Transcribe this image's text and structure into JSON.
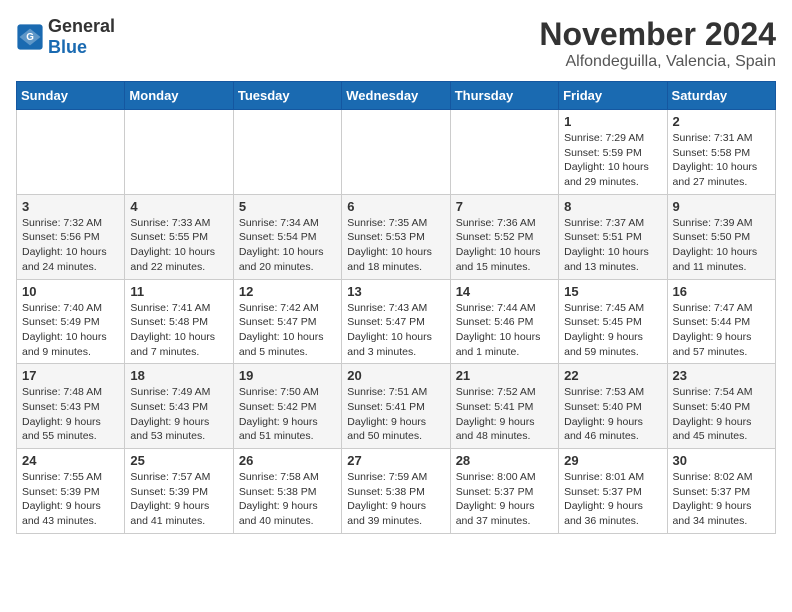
{
  "logo": {
    "text_general": "General",
    "text_blue": "Blue"
  },
  "header": {
    "month": "November 2024",
    "location": "Alfondeguilla, Valencia, Spain"
  },
  "weekdays": [
    "Sunday",
    "Monday",
    "Tuesday",
    "Wednesday",
    "Thursday",
    "Friday",
    "Saturday"
  ],
  "weeks": [
    [
      {
        "day": "",
        "info": ""
      },
      {
        "day": "",
        "info": ""
      },
      {
        "day": "",
        "info": ""
      },
      {
        "day": "",
        "info": ""
      },
      {
        "day": "",
        "info": ""
      },
      {
        "day": "1",
        "info": "Sunrise: 7:29 AM\nSunset: 5:59 PM\nDaylight: 10 hours and 29 minutes."
      },
      {
        "day": "2",
        "info": "Sunrise: 7:31 AM\nSunset: 5:58 PM\nDaylight: 10 hours and 27 minutes."
      }
    ],
    [
      {
        "day": "3",
        "info": "Sunrise: 7:32 AM\nSunset: 5:56 PM\nDaylight: 10 hours and 24 minutes."
      },
      {
        "day": "4",
        "info": "Sunrise: 7:33 AM\nSunset: 5:55 PM\nDaylight: 10 hours and 22 minutes."
      },
      {
        "day": "5",
        "info": "Sunrise: 7:34 AM\nSunset: 5:54 PM\nDaylight: 10 hours and 20 minutes."
      },
      {
        "day": "6",
        "info": "Sunrise: 7:35 AM\nSunset: 5:53 PM\nDaylight: 10 hours and 18 minutes."
      },
      {
        "day": "7",
        "info": "Sunrise: 7:36 AM\nSunset: 5:52 PM\nDaylight: 10 hours and 15 minutes."
      },
      {
        "day": "8",
        "info": "Sunrise: 7:37 AM\nSunset: 5:51 PM\nDaylight: 10 hours and 13 minutes."
      },
      {
        "day": "9",
        "info": "Sunrise: 7:39 AM\nSunset: 5:50 PM\nDaylight: 10 hours and 11 minutes."
      }
    ],
    [
      {
        "day": "10",
        "info": "Sunrise: 7:40 AM\nSunset: 5:49 PM\nDaylight: 10 hours and 9 minutes."
      },
      {
        "day": "11",
        "info": "Sunrise: 7:41 AM\nSunset: 5:48 PM\nDaylight: 10 hours and 7 minutes."
      },
      {
        "day": "12",
        "info": "Sunrise: 7:42 AM\nSunset: 5:47 PM\nDaylight: 10 hours and 5 minutes."
      },
      {
        "day": "13",
        "info": "Sunrise: 7:43 AM\nSunset: 5:47 PM\nDaylight: 10 hours and 3 minutes."
      },
      {
        "day": "14",
        "info": "Sunrise: 7:44 AM\nSunset: 5:46 PM\nDaylight: 10 hours and 1 minute."
      },
      {
        "day": "15",
        "info": "Sunrise: 7:45 AM\nSunset: 5:45 PM\nDaylight: 9 hours and 59 minutes."
      },
      {
        "day": "16",
        "info": "Sunrise: 7:47 AM\nSunset: 5:44 PM\nDaylight: 9 hours and 57 minutes."
      }
    ],
    [
      {
        "day": "17",
        "info": "Sunrise: 7:48 AM\nSunset: 5:43 PM\nDaylight: 9 hours and 55 minutes."
      },
      {
        "day": "18",
        "info": "Sunrise: 7:49 AM\nSunset: 5:43 PM\nDaylight: 9 hours and 53 minutes."
      },
      {
        "day": "19",
        "info": "Sunrise: 7:50 AM\nSunset: 5:42 PM\nDaylight: 9 hours and 51 minutes."
      },
      {
        "day": "20",
        "info": "Sunrise: 7:51 AM\nSunset: 5:41 PM\nDaylight: 9 hours and 50 minutes."
      },
      {
        "day": "21",
        "info": "Sunrise: 7:52 AM\nSunset: 5:41 PM\nDaylight: 9 hours and 48 minutes."
      },
      {
        "day": "22",
        "info": "Sunrise: 7:53 AM\nSunset: 5:40 PM\nDaylight: 9 hours and 46 minutes."
      },
      {
        "day": "23",
        "info": "Sunrise: 7:54 AM\nSunset: 5:40 PM\nDaylight: 9 hours and 45 minutes."
      }
    ],
    [
      {
        "day": "24",
        "info": "Sunrise: 7:55 AM\nSunset: 5:39 PM\nDaylight: 9 hours and 43 minutes."
      },
      {
        "day": "25",
        "info": "Sunrise: 7:57 AM\nSunset: 5:39 PM\nDaylight: 9 hours and 41 minutes."
      },
      {
        "day": "26",
        "info": "Sunrise: 7:58 AM\nSunset: 5:38 PM\nDaylight: 9 hours and 40 minutes."
      },
      {
        "day": "27",
        "info": "Sunrise: 7:59 AM\nSunset: 5:38 PM\nDaylight: 9 hours and 39 minutes."
      },
      {
        "day": "28",
        "info": "Sunrise: 8:00 AM\nSunset: 5:37 PM\nDaylight: 9 hours and 37 minutes."
      },
      {
        "day": "29",
        "info": "Sunrise: 8:01 AM\nSunset: 5:37 PM\nDaylight: 9 hours and 36 minutes."
      },
      {
        "day": "30",
        "info": "Sunrise: 8:02 AM\nSunset: 5:37 PM\nDaylight: 9 hours and 34 minutes."
      }
    ]
  ]
}
